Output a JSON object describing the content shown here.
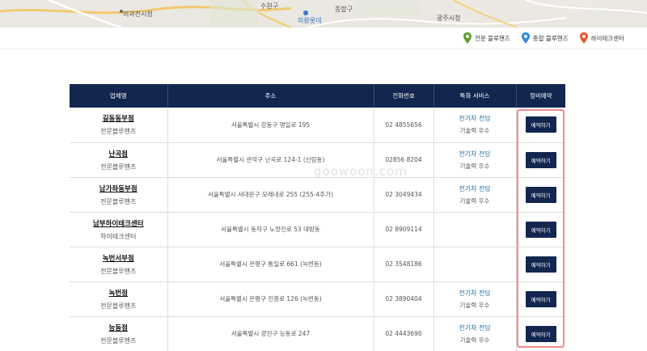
{
  "map": {
    "labels": [
      "의과천시청",
      "수원구",
      "의왕롯데",
      "종합구",
      "광주시청"
    ]
  },
  "legend": [
    {
      "label": "전문 블루핸즈",
      "color": "#5aa02c"
    },
    {
      "label": "종합 블루핸즈",
      "color": "#2b8be0"
    },
    {
      "label": "하이테크센터",
      "color": "#e3592b"
    }
  ],
  "table": {
    "headers": [
      "업체명",
      "주소",
      "전화번호",
      "특화 서비스",
      "정비예약"
    ],
    "rows": [
      {
        "name": "길동동부점",
        "type": "전문블루핸즈",
        "address": "서울특별시 강동구 명일로 195",
        "phone": "02 4855656",
        "service": "전기차 전담",
        "service_sub": "기술력 우수",
        "button": "예약하기"
      },
      {
        "name": "난곡점",
        "type": "전문블루핸즈",
        "address": "서울특별시 관악구 난곡로 124-1 (신림동)",
        "phone": "02856 8204",
        "service": "전기차 전담",
        "service_sub": "기술력 우수",
        "button": "예약하기"
      },
      {
        "name": "남가좌동부점",
        "type": "전문블루핸즈",
        "address": "서울특별시 서대문구 모래내로 255 (255-4추가)",
        "phone": "02 3049434",
        "service": "전기차 전담",
        "service_sub": "기술력 우수",
        "button": "예약하기"
      },
      {
        "name": "남부하이테크센터",
        "type": "하이테크센터",
        "address": "서울특별시 동작구 노량진로 53 대방동",
        "phone": "02 8909114",
        "service": "",
        "service_sub": "",
        "button": "예약하기"
      },
      {
        "name": "녹번서부점",
        "type": "전문블루핸즈",
        "address": "서울특별시 은평구 통일로 661 (녹번동)",
        "phone": "02 3548186",
        "service": "",
        "service_sub": "",
        "button": "예약하기"
      },
      {
        "name": "녹번점",
        "type": "전문블루핸즈",
        "address": "서울특별시 은평구 진흥로 126 (녹번동)",
        "phone": "02 3890404",
        "service": "전기차 전담",
        "service_sub": "기술력 우수",
        "button": "예약하기"
      },
      {
        "name": "능동점",
        "type": "전문블루핸즈",
        "address": "서울특별시 광진구 능동로 247",
        "phone": "02 4443690",
        "service": "전기차 전담",
        "service_sub": "기술력 우수",
        "button": "예약하기"
      }
    ]
  },
  "watermark": "goowoon.com"
}
